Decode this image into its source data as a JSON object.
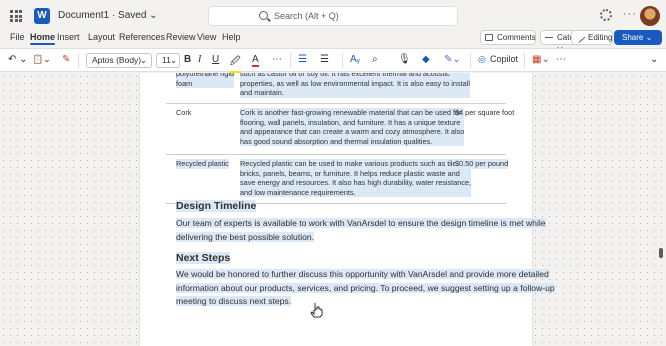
{
  "titlebar": {
    "doc_title": "Document1 · Saved ⌄",
    "search_placeholder": "Search (Alt + Q)",
    "app_letter": "W"
  },
  "menu": {
    "tabs": [
      "File",
      "Home",
      "Insert",
      "Layout",
      "References",
      "Review",
      "View",
      "Help"
    ],
    "comments": "Comments",
    "catch_up": "Catch Up",
    "editing": "Editing ⌄",
    "share": "Share ⌄"
  },
  "ribbon": {
    "undo": "↶ ⌄",
    "paste": "📋⌄",
    "format_painter": "✎",
    "font": "Aptos (Body)",
    "size": "11",
    "bold": "B",
    "italic": "I",
    "underline": "U",
    "highlight": "🖉",
    "font_color": "A",
    "more": "⋯",
    "bullets": "☰",
    "align": "☰",
    "styles": "Aᵧ",
    "find": "⌕",
    "dictate": "🎙",
    "copilot": "Copilot",
    "overflow": "⋯",
    "collapse": "⌄"
  },
  "table_rows": [
    {
      "material": "polyurethane rigid\nfoam",
      "description": "such as castor oil or soy oil. It has excellent thermal and acoustic\nproperties, as well as low environmental impact. It is also easy to install\nand maintain.",
      "price": ""
    },
    {
      "material": "Cork",
      "description": "Cork is another fast-growing renewable material that can be used for\nflooring, wall panels, insulation, and furniture. It has a unique texture\nand appearance that can create a warm and cozy atmosphere. It also\nhas good sound absorption and thermal insulation qualities.",
      "price": "$4 per square foot"
    },
    {
      "material": "Recycled plastic",
      "description": "Recycled plastic can be used to make various products such as tiles,\nbricks, panels, beams, or furniture. It helps reduce plastic waste and\nsave energy and resources. It also has high durability, water resistance,\nand low maintenance requirements.",
      "price": "$0.50 per pound"
    }
  ],
  "sections": [
    {
      "heading": "Design Timeline",
      "body": "Our team of experts is available to work with VanArsdel to ensure the design timeline is met while\ndelivering the best possible solution."
    },
    {
      "heading": "Next Steps",
      "body": "We would be honored to further discuss this opportunity with VanArsdel and provide more detailed\ninformation about our products, services, and pricing. To proceed, we suggest setting up a follow-up\nmeeting to discuss next steps."
    }
  ],
  "colors": {
    "accent": "#185abd",
    "selection": "#dbe8f6",
    "canvas": "#f3f2f1"
  }
}
